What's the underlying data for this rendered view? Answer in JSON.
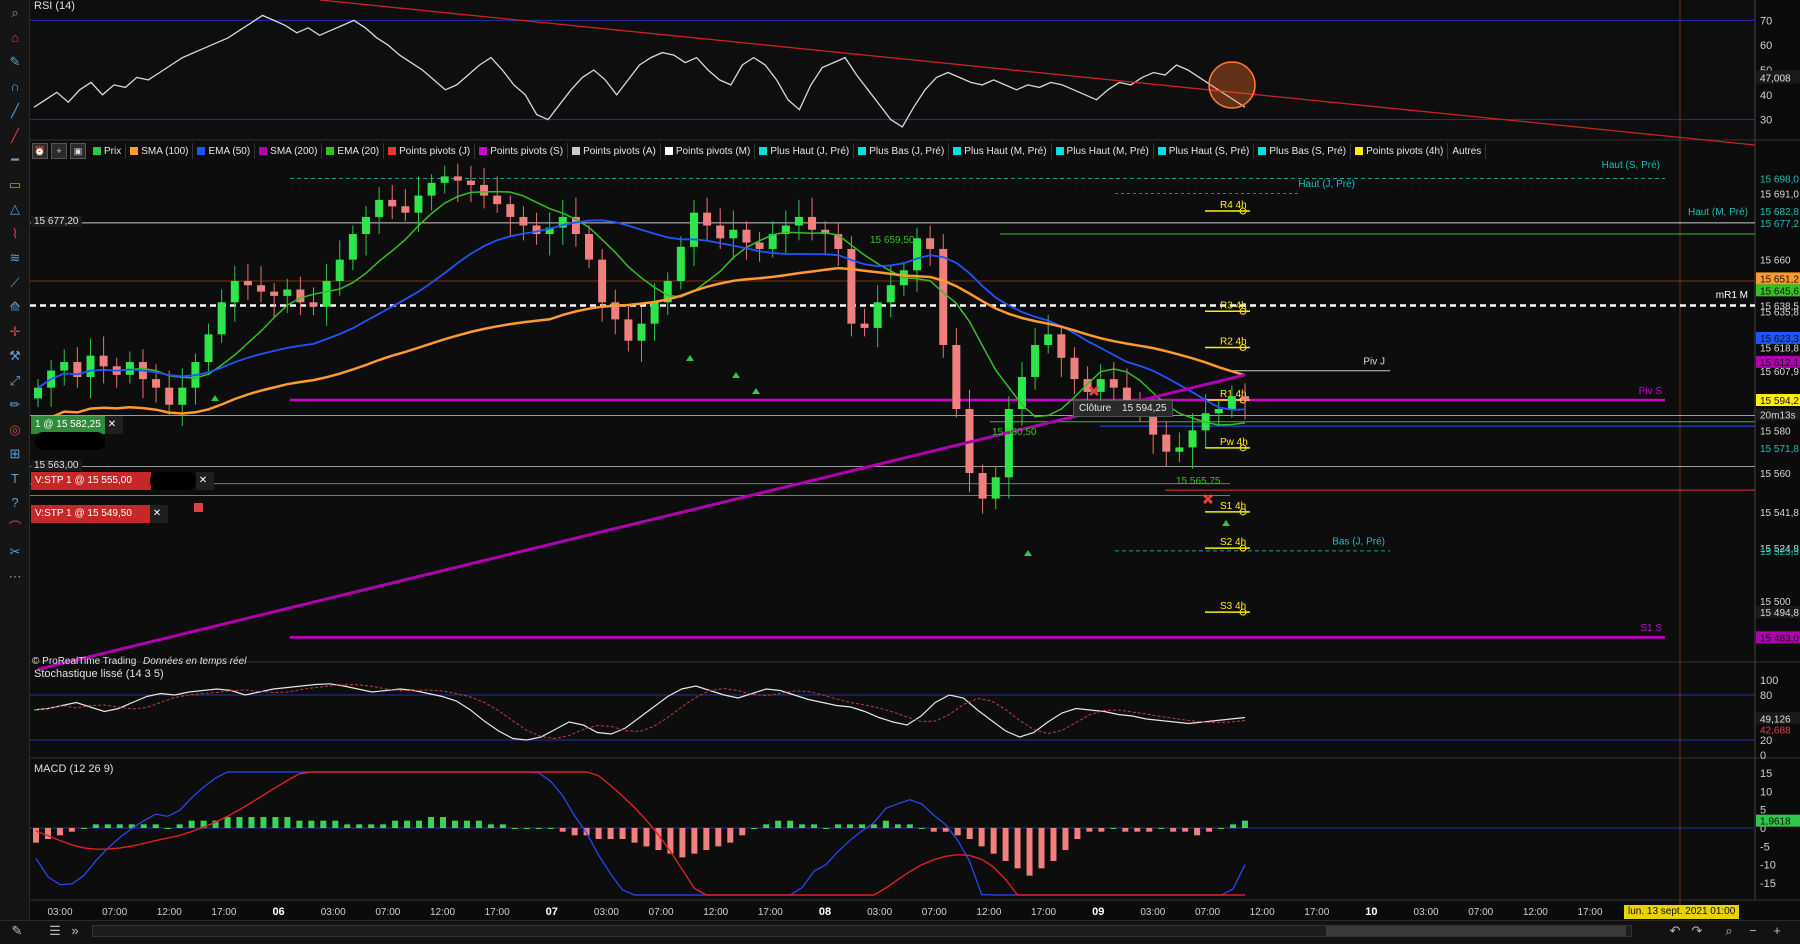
{
  "watermark": {
    "brand": "© ProRealTime Trading",
    "note": "Données en temps réel"
  },
  "rsi": {
    "title": "RSI (14)",
    "ticks": [
      "70",
      "60",
      "50",
      "40",
      "30"
    ],
    "value_label": "47,008",
    "series": [
      35,
      38,
      41,
      37,
      42,
      45,
      40,
      44,
      43,
      47,
      46,
      49,
      52,
      55,
      57,
      59,
      61,
      63,
      66,
      69,
      72,
      70,
      68,
      65,
      67,
      64,
      66,
      68,
      70,
      67,
      63,
      60,
      56,
      53,
      50,
      46,
      42,
      44,
      48,
      52,
      55,
      50,
      44,
      40,
      32,
      30,
      36,
      42,
      47,
      50,
      46,
      40,
      46,
      52,
      55,
      57,
      56,
      53,
      55,
      50,
      46,
      44,
      52,
      55,
      52,
      46,
      38,
      34,
      44,
      51,
      53,
      55,
      48,
      42,
      36,
      30,
      27,
      35,
      42,
      47,
      49,
      47,
      45,
      44,
      46,
      44,
      42,
      44,
      43,
      45,
      44,
      42,
      40,
      38,
      42,
      45,
      44,
      47,
      49,
      48,
      52,
      50,
      47,
      44,
      41,
      38,
      35
    ]
  },
  "price": {
    "legend": [
      {
        "label": "Prix",
        "color": "#2ec74a"
      },
      {
        "label": "SMA (100)",
        "color": "#ff9a30"
      },
      {
        "label": "EMA (50)",
        "color": "#1f55ff"
      },
      {
        "label": "SMA (200)",
        "color": "#b000b0"
      },
      {
        "label": "EMA (20)",
        "color": "#34c020"
      },
      {
        "label": "Points pivots (J)",
        "color": "#e53935"
      },
      {
        "label": "Points pivots (S)",
        "color": "#d000d0"
      },
      {
        "label": "Points pivots (A)",
        "color": "#cccccc"
      },
      {
        "label": "Points pivots (M)",
        "color": "#ffffff"
      },
      {
        "label": "Plus Haut (J, Pré)",
        "color": "#00e0e0"
      },
      {
        "label": "Plus Bas (J, Pré)",
        "color": "#00e0e0"
      },
      {
        "label": "Plus Haut (M, Pré)",
        "color": "#00e0e0"
      },
      {
        "label": "Plus Haut (M, Pré)",
        "color": "#00e0e0"
      },
      {
        "label": "Plus Haut (S, Pré)",
        "color": "#00e0e0"
      },
      {
        "label": "Plus Bas (S, Pré)",
        "color": "#00e0e0"
      },
      {
        "label": "Points pivots (4h)",
        "color": "#ffee00"
      },
      {
        "label": "Autres",
        "color": ""
      }
    ],
    "axis_ticks": [
      "15 698,0",
      "15 691,0",
      "15 682,8",
      "15 677,2",
      "15 660",
      "15 651,2",
      "15 645,6",
      "15 638,5",
      "15 635,8",
      "15 623,3",
      "15 618,8",
      "15 612,1",
      "15 607,9",
      "15 594,2",
      "20m13s",
      "15 580",
      "15 571,8",
      "15 560",
      "15 541,8",
      "15 524,8",
      "15 523,5",
      "15 500",
      "15 494,8",
      "15 483,0"
    ],
    "left_price_labels": {
      "top": "15 677,20",
      "low": "15 563,00"
    },
    "levels": [
      {
        "label": "Haut (S, Pré)",
        "value": 15698
      },
      {
        "label": "Haut (J, Pré)",
        "value": 15691
      },
      {
        "label": "R4 4h",
        "value": 15682.8
      },
      {
        "label": "Haut (M, Pré)",
        "value": 15677.2
      },
      {
        "label": "mR1 M",
        "value": 15638.5
      },
      {
        "label": "R3 4h",
        "value": 15635.8
      },
      {
        "label": "R2 4h",
        "value": 15618.8
      },
      {
        "label": "Piv J",
        "value": 15607.9
      },
      {
        "label": "R1 4h",
        "value": 15594.2
      },
      {
        "label": "Piv S",
        "value": 15594.2
      },
      {
        "label": "Pw 4h",
        "value": 15571.8
      },
      {
        "label": "S1 4h",
        "value": 15541.8
      },
      {
        "label": "S2 4h",
        "value": 15524.8
      },
      {
        "label": "Bas (J, Pré)",
        "value": 15523.5
      },
      {
        "label": "S3 4h",
        "value": 15494.8
      },
      {
        "label": "S1 S",
        "value": 15483
      }
    ],
    "inline_labels": {
      "sma_label": "15 659,50",
      "ema_label": "15 580,50",
      "low_label": "15 565,75"
    },
    "tooltip": {
      "label": "Clôture",
      "value": "15 594,25"
    },
    "orders": [
      {
        "label": "1 @ 15 582,25",
        "color": "#2e8b3a"
      },
      {
        "label": "V:STP 1 @ 15 555,00",
        "color": "#c62828"
      },
      {
        "label": "V:STP 1 @ 15 549,50",
        "color": "#c62828"
      }
    ],
    "candle_closes": [
      15600,
      15608,
      15612,
      15605,
      15615,
      15610,
      15606,
      15612,
      15604,
      15600,
      15592,
      15600,
      15612,
      15625,
      15640,
      15650,
      15648,
      15645,
      15643,
      15646,
      15640,
      15638,
      15650,
      15660,
      15672,
      15680,
      15688,
      15685,
      15682,
      15690,
      15696,
      15699,
      15697,
      15695,
      15690,
      15686,
      15680,
      15676,
      15672,
      15675,
      15680,
      15672,
      15660,
      15640,
      15632,
      15622,
      15630,
      15640,
      15650,
      15666,
      15682,
      15676,
      15670,
      15674,
      15668,
      15665,
      15672,
      15676,
      15680,
      15674,
      15672,
      15665,
      15630,
      15628,
      15640,
      15648,
      15655,
      15670,
      15665,
      15620,
      15590,
      15560,
      15548,
      15558,
      15590,
      15605,
      15620,
      15625,
      15614,
      15604,
      15598,
      15604,
      15600,
      15594,
      15588,
      15578,
      15570,
      15572,
      15580,
      15588,
      15590,
      15596,
      15594
    ],
    "candle_opens": [
      15595,
      15600,
      15608,
      15612,
      15605,
      15615,
      15610,
      15606,
      15612,
      15604,
      15600,
      15592,
      15600,
      15612,
      15625,
      15640,
      15650,
      15648,
      15645,
      15643,
      15646,
      15640,
      15638,
      15650,
      15660,
      15672,
      15680,
      15688,
      15685,
      15682,
      15690,
      15696,
      15699,
      15697,
      15695,
      15690,
      15686,
      15680,
      15676,
      15672,
      15675,
      15680,
      15672,
      15660,
      15640,
      15632,
      15622,
      15630,
      15640,
      15650,
      15666,
      15682,
      15676,
      15670,
      15674,
      15668,
      15665,
      15672,
      15676,
      15680,
      15674,
      15672,
      15665,
      15630,
      15628,
      15640,
      15648,
      15655,
      15670,
      15665,
      15620,
      15590,
      15560,
      15548,
      15558,
      15590,
      15605,
      15620,
      15625,
      15614,
      15604,
      15598,
      15604,
      15600,
      15594,
      15588,
      15578,
      15570,
      15572,
      15580,
      15588,
      15590,
      15596
    ]
  },
  "stoch": {
    "title": "Stochastique lissé (14 3 5)",
    "ticks": [
      "100",
      "80",
      "20",
      "0"
    ],
    "value_labels": [
      "49,126",
      "42,688"
    ],
    "k": [
      60,
      62,
      66,
      70,
      64,
      58,
      62,
      70,
      78,
      82,
      80,
      84,
      86,
      88,
      86,
      80,
      84,
      88,
      90,
      92,
      94,
      95,
      92,
      88,
      84,
      86,
      88,
      86,
      82,
      78,
      72,
      60,
      45,
      32,
      22,
      20,
      24,
      34,
      44,
      40,
      30,
      28,
      36,
      50,
      64,
      78,
      88,
      92,
      86,
      80,
      76,
      82,
      88,
      86,
      80,
      74,
      70,
      66,
      64,
      58,
      50,
      44,
      40,
      52,
      70,
      80,
      76,
      60,
      46,
      32,
      24,
      30,
      44,
      56,
      62,
      60,
      58,
      54,
      52,
      48,
      46,
      44,
      42,
      44,
      46,
      48,
      50
    ]
  },
  "macd": {
    "title": "MACD (12 26 9)",
    "ticks": [
      "15",
      "10",
      "5",
      "0",
      "-5",
      "-10",
      "-15"
    ],
    "value_labels": [
      "1,9618"
    ],
    "hist": [
      -4,
      -3,
      -2,
      -1,
      0,
      1,
      1,
      1,
      1,
      1,
      1,
      0,
      1,
      2,
      2,
      2,
      3,
      3,
      3,
      3,
      3,
      3,
      2,
      2,
      2,
      2,
      1,
      1,
      1,
      1,
      2,
      2,
      2,
      3,
      3,
      2,
      2,
      2,
      1,
      1,
      0,
      0,
      0,
      0,
      -1,
      -2,
      -2,
      -3,
      -3,
      -3,
      -4,
      -5,
      -6,
      -7,
      -8,
      -7,
      -6,
      -5,
      -4,
      -2,
      0,
      1,
      2,
      2,
      1,
      1,
      0,
      1,
      1,
      1,
      1,
      2,
      1,
      1,
      0,
      -1,
      -1,
      -2,
      -3,
      -5,
      -7,
      -9,
      -11,
      -13,
      -11,
      -9,
      -6,
      -3,
      -1,
      -1,
      0,
      -1,
      -1,
      -1,
      0,
      -1,
      -1,
      -2,
      -1,
      0,
      1,
      2
    ]
  },
  "time_axis": [
    "03:00",
    "07:00",
    "12:00",
    "17:00",
    "06",
    "03:00",
    "07:00",
    "12:00",
    "17:00",
    "07",
    "03:00",
    "07:00",
    "12:00",
    "17:00",
    "08",
    "03:00",
    "07:00",
    "12:00",
    "17:00",
    "09",
    "03:00",
    "07:00",
    "12:00",
    "17:00",
    "10",
    "03:00",
    "07:00",
    "12:00",
    "17:00"
  ],
  "date_flag": "lun. 13 sept. 2021 01:00"
}
